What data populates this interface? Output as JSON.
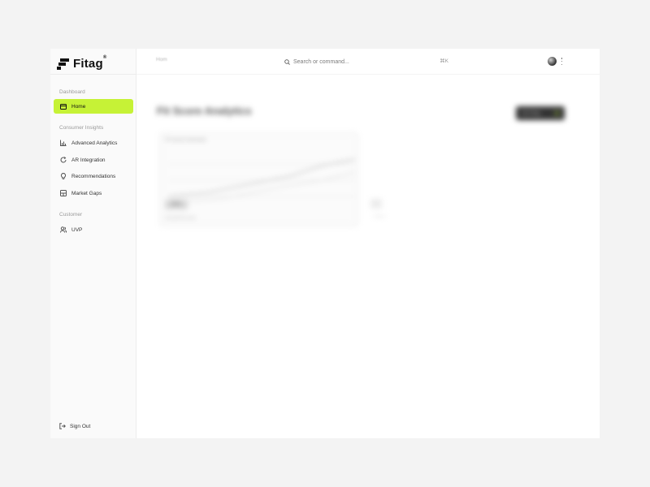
{
  "app": {
    "brand": "Fitag",
    "brand_mark": "®"
  },
  "sidebar": {
    "sections": [
      {
        "label": "Dashboard"
      },
      {
        "label": "Consumer Insights"
      },
      {
        "label": "Customer"
      }
    ],
    "items": [
      {
        "label": "Home",
        "icon": "layout-icon",
        "active": true
      },
      {
        "label": "Advanced Analytics",
        "icon": "bar-chart-icon",
        "active": false
      },
      {
        "label": "AR Integration",
        "icon": "refresh-icon",
        "active": false
      },
      {
        "label": "Recommendations",
        "icon": "lightbulb-icon",
        "active": false
      },
      {
        "label": "Market Gaps",
        "icon": "grid-box-icon",
        "active": false
      },
      {
        "label": "UVP",
        "icon": "users-icon",
        "active": false
      }
    ],
    "sign_out": "Sign Out"
  },
  "topbar": {
    "breadcrumb": "Hom",
    "search_placeholder": "Search or command...",
    "shortcut": "⌘K"
  },
  "main": {
    "title": "Fit Score Analytics",
    "primary_button": "Get Fitag",
    "card": {
      "label": "Fit Score Overview",
      "value": "82%",
      "sub": "Overall fit score"
    }
  },
  "colors": {
    "accent": "#c6f236",
    "sidebar_bg": "#fafafa"
  }
}
